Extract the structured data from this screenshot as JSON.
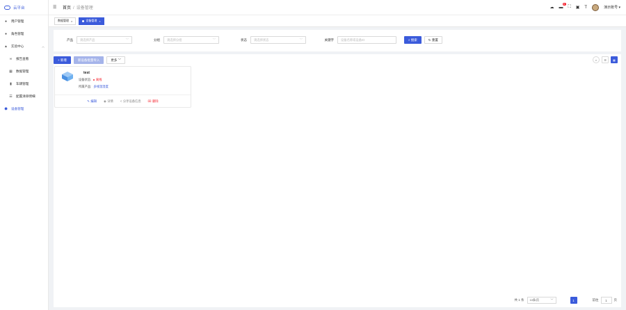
{
  "sidebar": {
    "logo": "云平台",
    "items": [
      {
        "label": "用户管理",
        "icon": "user-icon"
      },
      {
        "label": "角色管理",
        "icon": "role-icon"
      },
      {
        "label": "实验中心",
        "icon": "home-icon"
      },
      {
        "label": "报告查看",
        "icon": "report-icon"
      },
      {
        "label": "数据管理",
        "icon": "grid-icon"
      },
      {
        "label": "车辆管理",
        "icon": "bar-chart-icon"
      },
      {
        "label": "配置清单明细",
        "icon": "list-icon"
      },
      {
        "label": "设备管理",
        "icon": "device-icon"
      }
    ]
  },
  "header": {
    "breadcrumb": [
      "首页",
      "设备管理"
    ],
    "notification_count": "6",
    "username": "演示账号"
  },
  "tags": [
    {
      "label": "数据管理"
    },
    {
      "label": "设备管理"
    }
  ],
  "search": {
    "product_label": "产品",
    "product_placeholder": "请选择产品",
    "group_label": "分组",
    "group_placeholder": "请选择分组",
    "status_label": "状态",
    "status_placeholder": "请选择状态",
    "keyword_label": "关键字",
    "keyword_placeholder": "设备名称或设备ID",
    "search_btn": "搜索",
    "reset_btn": "重置"
  },
  "toolbar": {
    "add_btn": "新增",
    "batch_btn": "新设备批量导入",
    "more_btn": "更多"
  },
  "device": {
    "name": "test",
    "status_label": "设备状态:",
    "status_value": "离线",
    "product_label": "所属产品:",
    "product_value": "多线温湿度"
  },
  "actions": {
    "edit": "编辑",
    "detail": "详情",
    "share": "分享设备信息",
    "delete": "删除"
  },
  "pagination": {
    "total": "共 1 条",
    "page_size": "10条/页",
    "current": "1",
    "goto_prefix": "前往",
    "goto_value": "1",
    "goto_suffix": "页"
  },
  "colors": {
    "primary": "#3b5bdb",
    "danger": "#f5222d"
  }
}
